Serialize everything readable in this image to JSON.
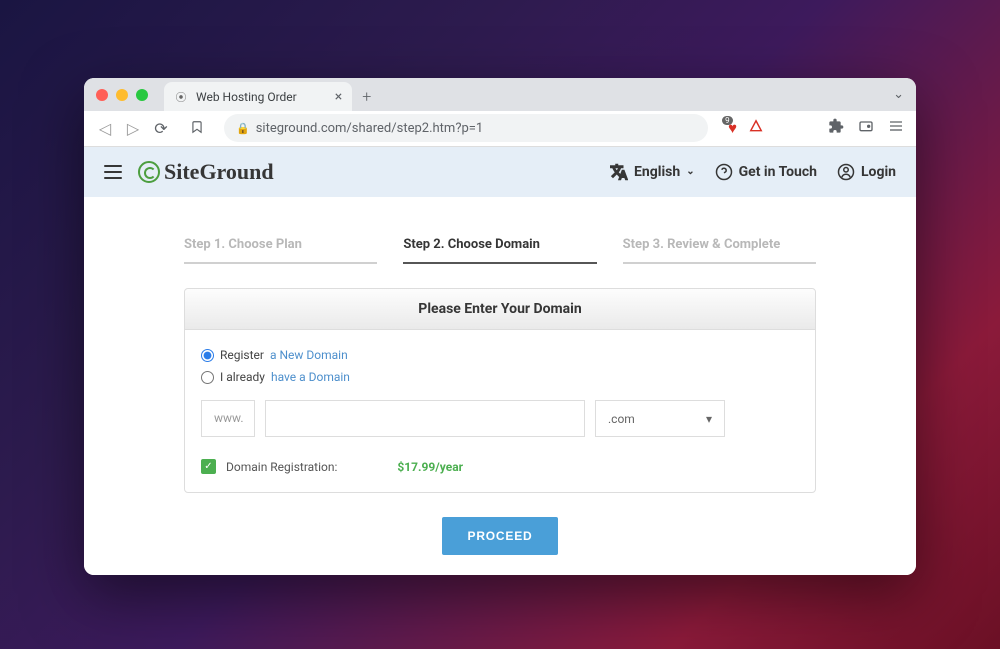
{
  "browser": {
    "tab_title": "Web Hosting Order",
    "url": "siteground.com/shared/step2.htm?p=1",
    "shield_count": "9"
  },
  "header": {
    "logo_text": "SiteGround",
    "language": "English",
    "get_in_touch": "Get in Touch",
    "login": "Login"
  },
  "steps": {
    "s1": "Step 1. Choose Plan",
    "s2": "Step 2. Choose Domain",
    "s3": "Step 3. Review & Complete"
  },
  "form": {
    "card_title": "Please Enter Your Domain",
    "register_prefix": "Register ",
    "register_link": "a New Domain",
    "already_prefix": "I already ",
    "already_link": "have a Domain",
    "www": "www.",
    "tld": ".com",
    "price_label": "Domain Registration:",
    "price_value": "$17.99/year"
  },
  "proceed": "PROCEED"
}
